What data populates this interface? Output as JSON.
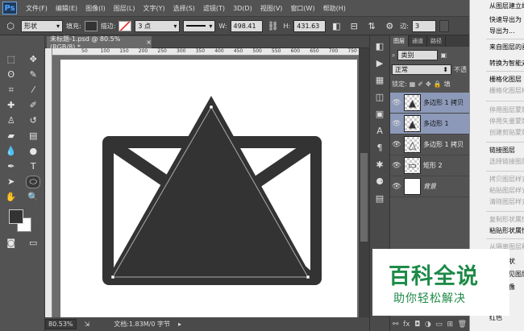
{
  "app": {
    "logo": "Ps"
  },
  "menu": [
    "文件(F)",
    "编辑(E)",
    "图像(I)",
    "图层(L)",
    "文字(Y)",
    "选择(S)",
    "滤镜(T)",
    "3D(D)",
    "视图(V)",
    "窗口(W)",
    "帮助(H)"
  ],
  "options": {
    "mode": "形状",
    "fill_label": "填充:",
    "stroke_label": "描边:",
    "stroke_size": "3 点",
    "w_label": "W:",
    "w_value": "498.41",
    "h_label": "H:",
    "h_value": "431.63",
    "sides_label": "边:",
    "sides_value": "3",
    "fill_color": "#333333"
  },
  "document": {
    "tab_title": "未标题-1.psd @ 80.5%(RGB/8) *",
    "ruler_marks": [
      "50",
      "100",
      "150",
      "200",
      "250",
      "300",
      "350",
      "400",
      "450",
      "500",
      "550",
      "600",
      "650",
      "700",
      "750",
      "800",
      "850"
    ],
    "zoom": "80.53%",
    "doc_size": "文档:1.83M/0 字节"
  },
  "layers_panel": {
    "tabs": [
      "图层",
      "通道",
      "路径"
    ],
    "kind_filter": "类别",
    "blend_mode": "正常",
    "opacity_label": "不透",
    "lock_label": "锁定:",
    "fill_label": "填",
    "layers": [
      {
        "name": "多边形 1 拷贝",
        "selected": true
      },
      {
        "name": "多边形 1",
        "selected": true
      },
      {
        "name": "多边形 1 拷贝",
        "selected": false
      },
      {
        "name": "矩形 2",
        "selected": false
      },
      {
        "name": "背景",
        "selected": false
      }
    ],
    "bottom_icons": [
      "link-icon",
      "fx-icon",
      "mask-icon",
      "adjust-icon",
      "folder-icon",
      "new-icon",
      "trash-icon"
    ]
  },
  "context_menu": {
    "items": [
      {
        "label": "从图层建立组...",
        "enabled": true
      },
      {
        "label": "快速导出为",
        "enabled": true
      },
      {
        "label": "导出为...",
        "enabled": true
      },
      {
        "label": "来自图层的画板...",
        "enabled": true
      },
      {
        "label": "转换为智能对象",
        "enabled": true
      },
      {
        "label": "栅格化图层",
        "enabled": true
      },
      {
        "label": "栅格化图层样式",
        "enabled": false
      },
      {
        "label": "停用图层蒙版",
        "enabled": false
      },
      {
        "label": "停用矢量蒙版",
        "enabled": false
      },
      {
        "label": "创建剪贴蒙版",
        "enabled": false
      },
      {
        "label": "链接图层",
        "enabled": true
      },
      {
        "label": "选择链接图层",
        "enabled": false
      },
      {
        "label": "拷贝图层样式",
        "enabled": false
      },
      {
        "label": "粘贴图层样式",
        "enabled": false
      },
      {
        "label": "清除图层样式",
        "enabled": false
      },
      {
        "label": "复制形状属性",
        "enabled": false
      },
      {
        "label": "粘贴形状属性",
        "enabled": true
      },
      {
        "label": "从隔离图层释放",
        "enabled": false
      },
      {
        "label": "合并形状",
        "enabled": true
      },
      {
        "label": "合并可见图层",
        "enabled": true
      },
      {
        "label": "拼合图像",
        "enabled": true
      },
      {
        "label": "无颜色",
        "enabled": true
      },
      {
        "label": "红色",
        "enabled": true
      }
    ]
  },
  "watermark": {
    "title": "百科全说",
    "subtitle": "助你轻松解决"
  }
}
